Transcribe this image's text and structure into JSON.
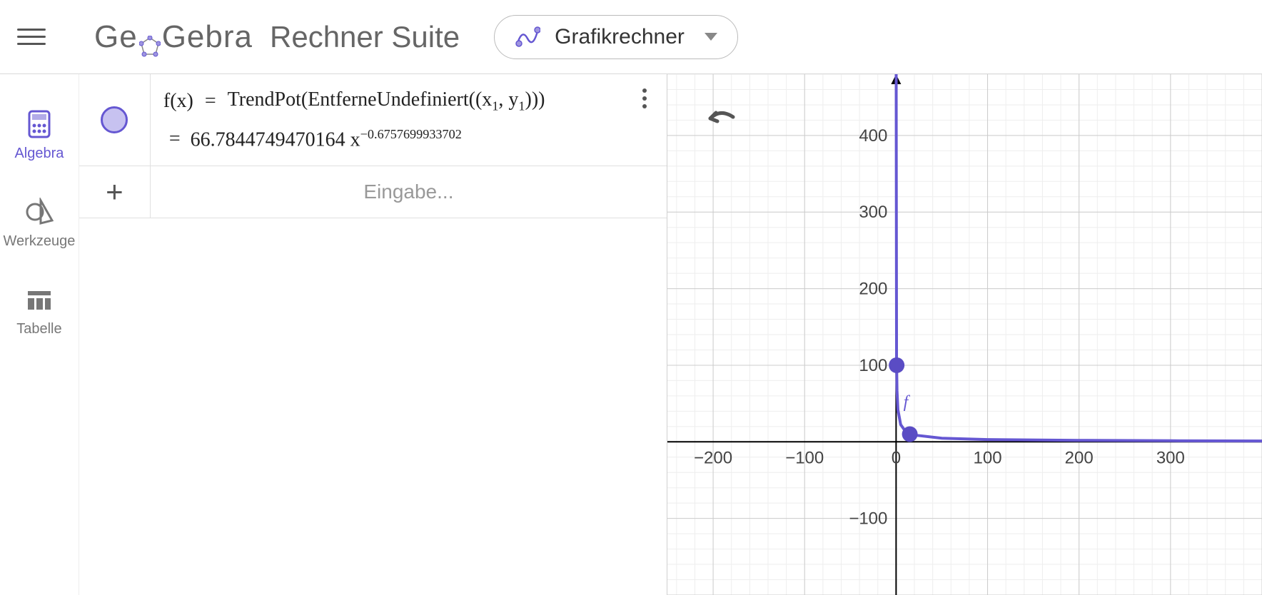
{
  "header": {
    "logo": "GeoGebra",
    "suite_title": "Rechner Suite",
    "app_selector_label": "Grafikrechner"
  },
  "sidebar": {
    "items": [
      {
        "label": "Algebra",
        "active": true
      },
      {
        "label": "Werkzeuge",
        "active": false
      },
      {
        "label": "Tabelle",
        "active": false
      }
    ]
  },
  "algebra": {
    "rows": [
      {
        "lhs": "f(x)",
        "rhs_command": "TrendPot(EntferneUndefiniert((x",
        "rhs_sub1": "1",
        "rhs_mid": ", y",
        "rhs_sub2": "1",
        "rhs_end": ")))",
        "numeric_prefix": "=",
        "numeric_coeff": "66.7844749470164 x",
        "numeric_exp": "−0.6757699933702"
      }
    ],
    "input_placeholder": "Eingabe..."
  },
  "chart_data": {
    "type": "line",
    "function_label": "f",
    "x_ticks": [
      -200,
      -100,
      0,
      100,
      200,
      300
    ],
    "y_ticks": [
      -100,
      100,
      200,
      300,
      400
    ],
    "xlim": [
      -250,
      400
    ],
    "ylim": [
      -200,
      480
    ],
    "points": [
      {
        "x": 0.6,
        "y": 100
      },
      {
        "x": 15,
        "y": 10
      }
    ],
    "curve_samples": [
      {
        "x": 0.1,
        "y": 480
      },
      {
        "x": 0.5,
        "y": 107
      },
      {
        "x": 1,
        "y": 66.8
      },
      {
        "x": 2,
        "y": 41.8
      },
      {
        "x": 5,
        "y": 22.5
      },
      {
        "x": 10,
        "y": 14.1
      },
      {
        "x": 20,
        "y": 8.8
      },
      {
        "x": 50,
        "y": 4.7
      },
      {
        "x": 100,
        "y": 3.0
      },
      {
        "x": 200,
        "y": 1.9
      },
      {
        "x": 300,
        "y": 1.4
      },
      {
        "x": 400,
        "y": 1.1
      }
    ]
  }
}
